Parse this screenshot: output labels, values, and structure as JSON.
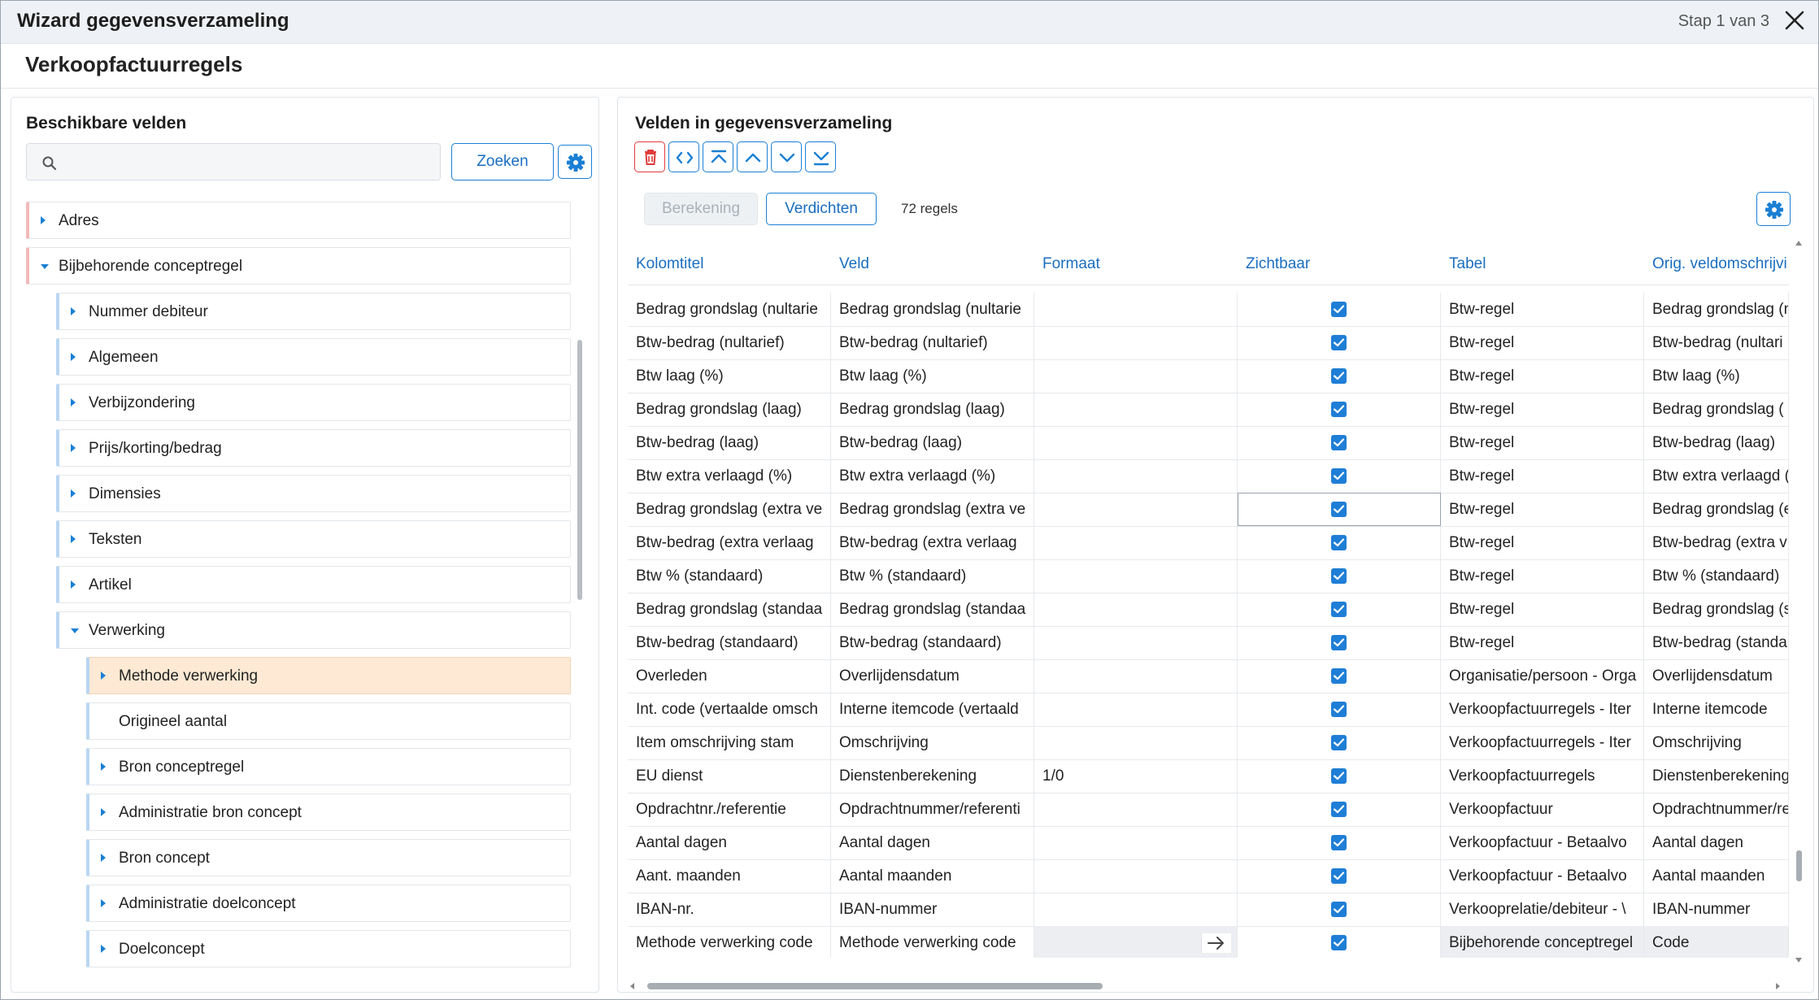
{
  "window": {
    "title": "Wizard gegevensverzameling",
    "step": "Stap 1 van 3"
  },
  "page": {
    "title": "Verkoopfactuurregels"
  },
  "left": {
    "title": "Beschikbare velden",
    "search_button": "Zoeken",
    "tree": [
      {
        "label": "Adres",
        "level": 0,
        "arrow": "right"
      },
      {
        "label": "Bijbehorende conceptregel",
        "level": 0,
        "arrow": "down"
      },
      {
        "label": "Nummer debiteur",
        "level": 1,
        "arrow": "right"
      },
      {
        "label": "Algemeen",
        "level": 1,
        "arrow": "right"
      },
      {
        "label": "Verbijzondering",
        "level": 1,
        "arrow": "right"
      },
      {
        "label": "Prijs/korting/bedrag",
        "level": 1,
        "arrow": "right"
      },
      {
        "label": "Dimensies",
        "level": 1,
        "arrow": "right"
      },
      {
        "label": "Teksten",
        "level": 1,
        "arrow": "right"
      },
      {
        "label": "Artikel",
        "level": 1,
        "arrow": "right"
      },
      {
        "label": "Verwerking",
        "level": 1,
        "arrow": "down"
      },
      {
        "label": "Methode verwerking",
        "level": 2,
        "arrow": "right",
        "selected": true
      },
      {
        "label": "Origineel aantal",
        "level": 2,
        "arrow": "none"
      },
      {
        "label": "Bron conceptregel",
        "level": 2,
        "arrow": "right"
      },
      {
        "label": "Administratie bron concept",
        "level": 2,
        "arrow": "right"
      },
      {
        "label": "Bron concept",
        "level": 2,
        "arrow": "right"
      },
      {
        "label": "Administratie doelconcept",
        "level": 2,
        "arrow": "right"
      },
      {
        "label": "Doelconcept",
        "level": 2,
        "arrow": "right"
      }
    ]
  },
  "right": {
    "title": "Velden in gegevensverzameling",
    "berekening": "Berekening",
    "verdichten": "Verdichten",
    "count": "72 regels",
    "columns": [
      "Kolomtitel",
      "Veld",
      "Formaat",
      "Zichtbaar",
      "Tabel",
      "Orig. veldomschrijvi"
    ],
    "rows": [
      {
        "kolomtitel": "Bedrag grondslag (nultarie",
        "veld": "Bedrag grondslag (nultarie",
        "formaat": "",
        "tabel": "Btw-regel",
        "orig": "Bedrag grondslag (n"
      },
      {
        "kolomtitel": "Btw-bedrag (nultarief)",
        "veld": "Btw-bedrag (nultarief)",
        "formaat": "",
        "tabel": "Btw-regel",
        "orig": "Btw-bedrag (nultari"
      },
      {
        "kolomtitel": "Btw laag (%)",
        "veld": "Btw laag (%)",
        "formaat": "",
        "tabel": "Btw-regel",
        "orig": "Btw laag (%)"
      },
      {
        "kolomtitel": "Bedrag grondslag  (laag)",
        "veld": "Bedrag grondslag  (laag)",
        "formaat": "",
        "tabel": "Btw-regel",
        "orig": "Bedrag grondslag  ("
      },
      {
        "kolomtitel": "Btw-bedrag (laag)",
        "veld": "Btw-bedrag (laag)",
        "formaat": "",
        "tabel": "Btw-regel",
        "orig": "Btw-bedrag (laag)"
      },
      {
        "kolomtitel": "Btw extra verlaagd (%)",
        "veld": "Btw extra verlaagd (%)",
        "formaat": "",
        "tabel": "Btw-regel",
        "orig": "Btw extra verlaagd ("
      },
      {
        "kolomtitel": "Bedrag grondslag (extra ve",
        "veld": "Bedrag grondslag (extra ve",
        "formaat": "",
        "tabel": "Btw-regel",
        "orig": "Bedrag grondslag (e"
      },
      {
        "kolomtitel": "Btw-bedrag (extra verlaag",
        "veld": "Btw-bedrag (extra verlaag",
        "formaat": "",
        "tabel": "Btw-regel",
        "orig": "Btw-bedrag (extra v"
      },
      {
        "kolomtitel": "Btw % (standaard)",
        "veld": "Btw % (standaard)",
        "formaat": "",
        "tabel": "Btw-regel",
        "orig": "Btw % (standaard)"
      },
      {
        "kolomtitel": "Bedrag grondslag (standaa",
        "veld": "Bedrag grondslag (standaa",
        "formaat": "",
        "tabel": "Btw-regel",
        "orig": "Bedrag grondslag (s"
      },
      {
        "kolomtitel": "Btw-bedrag (standaard)",
        "veld": "Btw-bedrag (standaard)",
        "formaat": "",
        "tabel": "Btw-regel",
        "orig": "Btw-bedrag (standa"
      },
      {
        "kolomtitel": "Overleden",
        "veld": "Overlijdensdatum",
        "formaat": "",
        "tabel": "Organisatie/persoon - Orga",
        "orig": "Overlijdensdatum"
      },
      {
        "kolomtitel": "Int. code (vertaalde omsch",
        "veld": "Interne itemcode (vertaald",
        "formaat": "",
        "tabel": "Verkoopfactuurregels - Iter",
        "orig": "Interne itemcode"
      },
      {
        "kolomtitel": "Item omschrijving stam",
        "veld": "Omschrijving",
        "formaat": "",
        "tabel": "Verkoopfactuurregels - Iter",
        "orig": "Omschrijving"
      },
      {
        "kolomtitel": "EU dienst",
        "veld": "Dienstenberekening",
        "formaat": "1/0",
        "tabel": "Verkoopfactuurregels",
        "orig": "Dienstenberekening"
      },
      {
        "kolomtitel": "Opdrachtnr./referentie",
        "veld": "Opdrachtnummer/referenti",
        "formaat": "",
        "tabel": "Verkoopfactuur",
        "orig": "Opdrachtnummer/re"
      },
      {
        "kolomtitel": "Aantal dagen",
        "veld": "Aantal dagen",
        "formaat": "",
        "tabel": "Verkoopfactuur - Betaalvo",
        "orig": "Aantal dagen"
      },
      {
        "kolomtitel": "Aant. maanden",
        "veld": "Aantal maanden",
        "formaat": "",
        "tabel": "Verkoopfactuur - Betaalvo",
        "orig": "Aantal maanden"
      },
      {
        "kolomtitel": "IBAN-nr.",
        "veld": "IBAN-nummer",
        "formaat": "",
        "tabel": "Verkooprelatie/debiteur - \\",
        "orig": "IBAN-nummer"
      },
      {
        "kolomtitel": "Methode verwerking code",
        "veld": "Methode verwerking code",
        "formaat": "",
        "tabel": "Bijbehorende conceptregel",
        "orig": "Code",
        "editing": true
      }
    ]
  },
  "colors": {
    "accent": "#1a7fd4",
    "danger": "#e03b3b",
    "selected": "#fde9d4",
    "checkbox": "#1f7ed6"
  }
}
